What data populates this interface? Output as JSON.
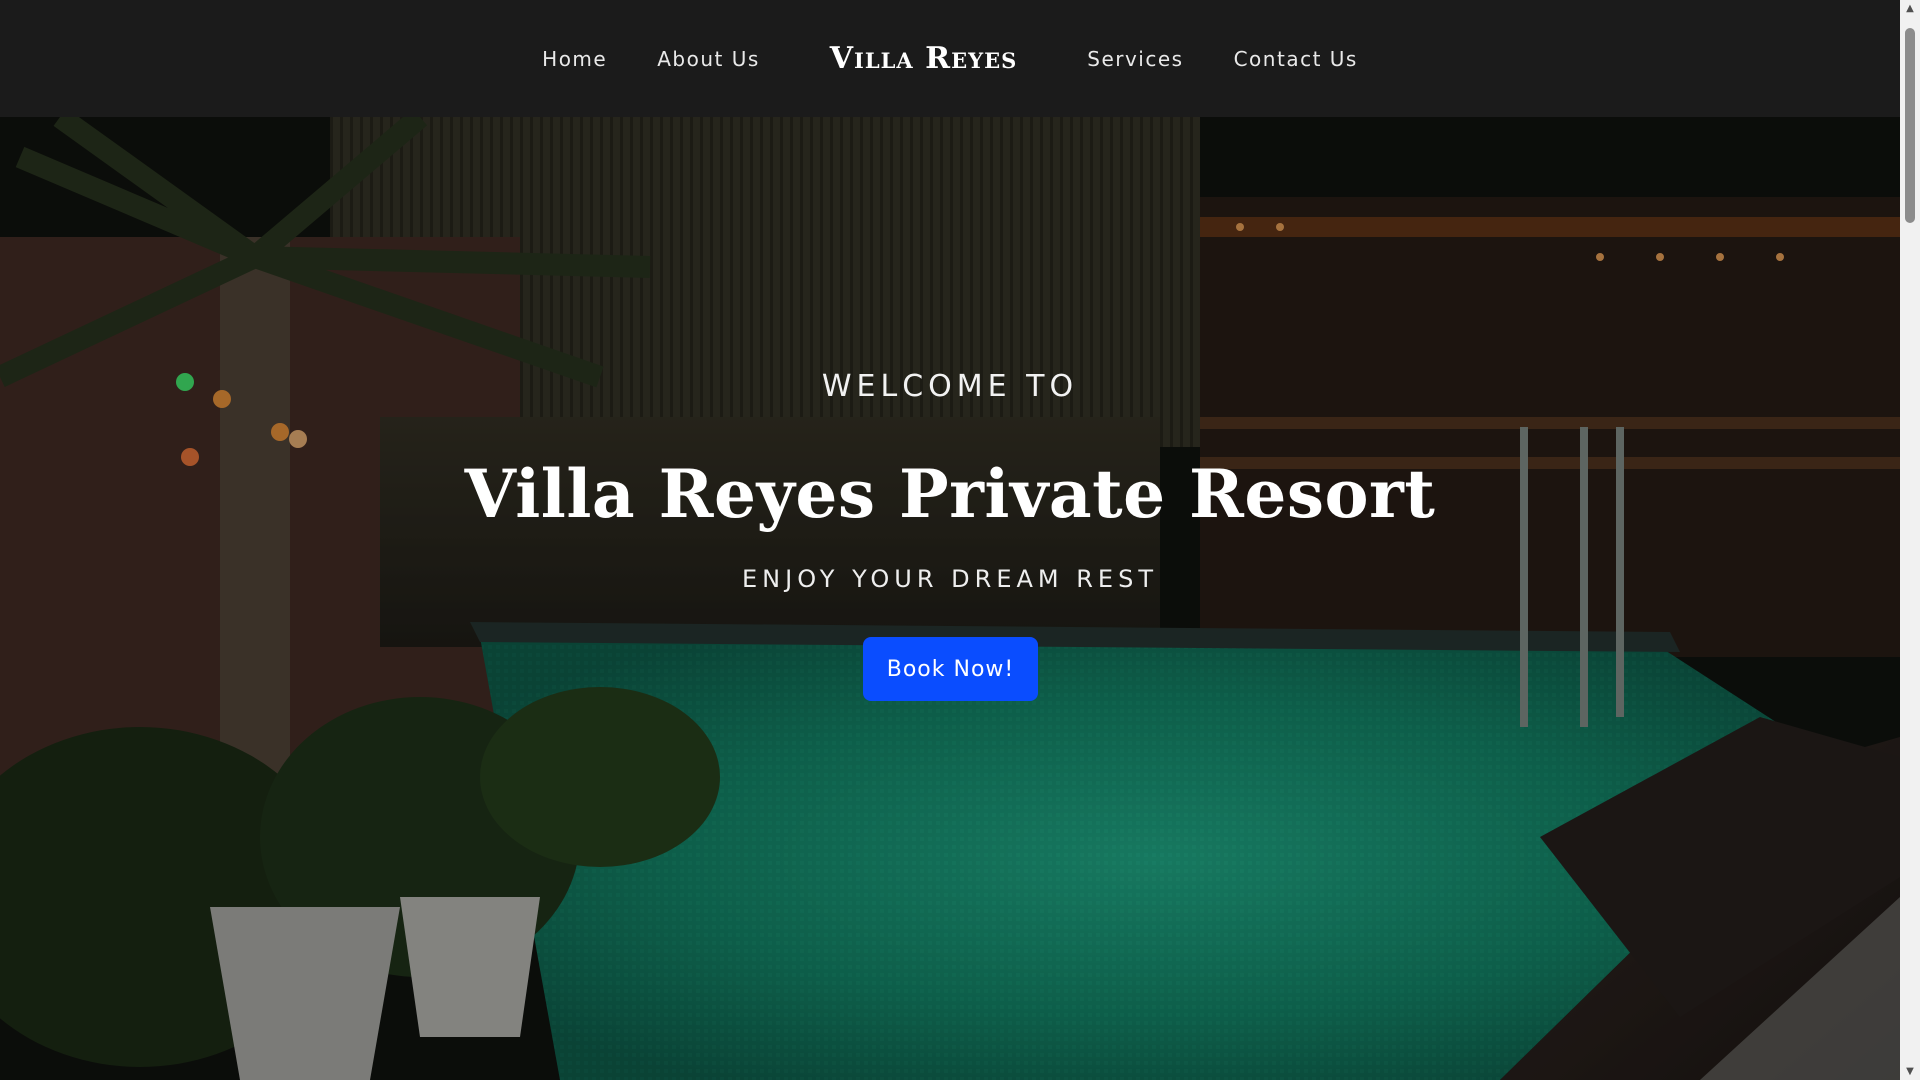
{
  "nav": {
    "links_left": [
      "Home",
      "About Us"
    ],
    "brand": "Villa Reyes",
    "links_right": [
      "Services",
      "Contact Us"
    ]
  },
  "hero": {
    "welcome": "WELCOME TO",
    "title": "Villa Reyes Private Resort",
    "tagline": "ENJOY YOUR DREAM REST",
    "cta_label": "Book Now!",
    "background": "night-time photo of a private resort swimming pool with palm plants and a wooden cabana"
  },
  "colors": {
    "nav_bg": "#1b1b1b",
    "cta_bg": "#0a4dff",
    "text": "#ffffff"
  },
  "icons": {
    "scroll_up": "▲",
    "scroll_down": "▼"
  }
}
